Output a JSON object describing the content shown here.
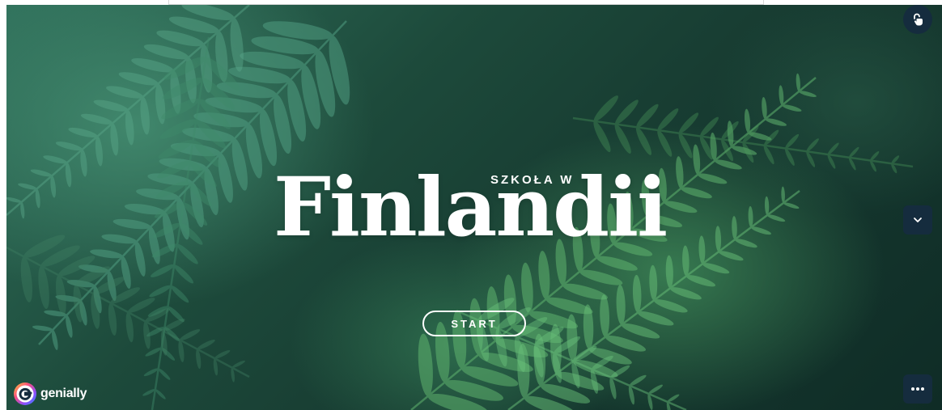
{
  "hero": {
    "subtitle": "SZKOŁA W",
    "title": "Finlandii",
    "start_label": "START"
  },
  "controls": {
    "lock_icon": "unlock-hand-icon",
    "nav_icon": "chevron-down-icon",
    "more_icon": "ellipsis-icon"
  },
  "brand": {
    "logo_text": "genially",
    "logo_icon": "genially-logo-icon"
  },
  "colors": {
    "accent_dark": "#152c3e",
    "text": "#ffffff",
    "background_green": "#1d4a3b"
  }
}
